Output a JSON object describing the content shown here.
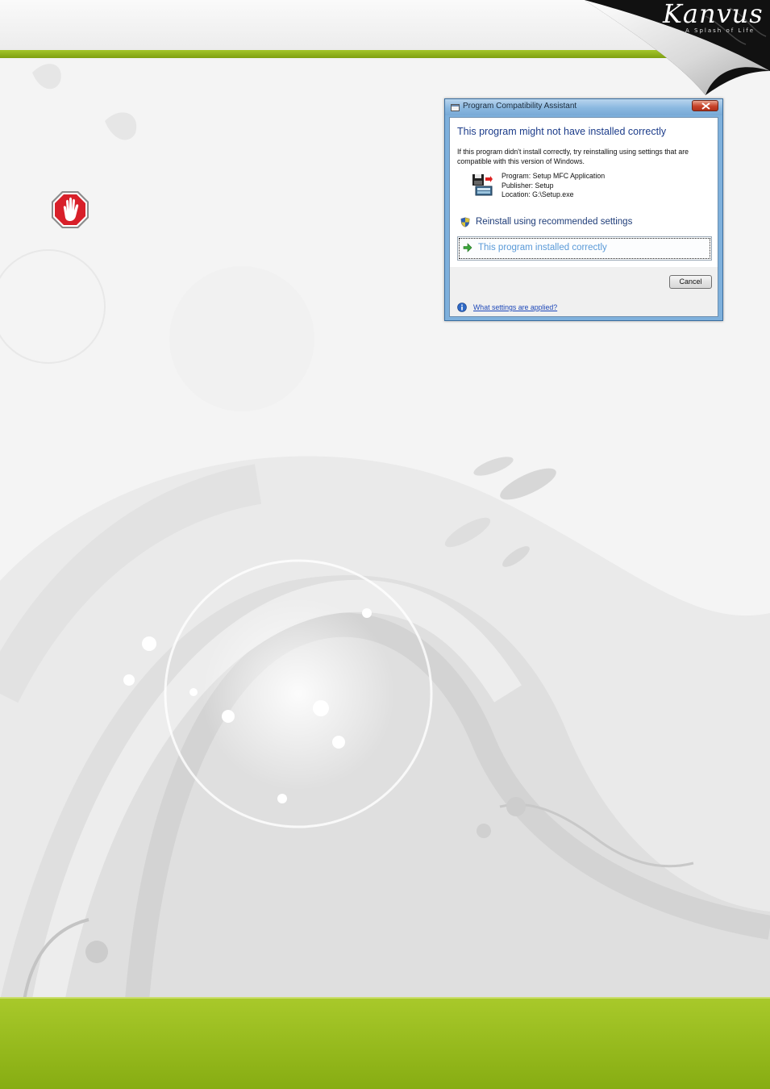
{
  "brand": {
    "logo_text": "Kanvus",
    "tagline": "A Splash of Life"
  },
  "colors": {
    "accent_green": "#96b71f",
    "dialog_frame": "#7eb0dc",
    "heading_blue": "#1c3c8a",
    "link_blue": "#1c47b8"
  },
  "icons": {
    "stop": "stop-hand-icon",
    "title": "window-icon",
    "program": "floppy-disk-icon",
    "shield": "shield-icon",
    "arrow": "green-arrow-icon",
    "info": "info-icon"
  },
  "dialog": {
    "title": "Program Compatibility Assistant",
    "heading": "This program might not have installed correctly",
    "description": "If this program didn't install correctly, try reinstalling using settings that are compatible with this version of Windows.",
    "program_line": "Program: Setup MFC Application",
    "publisher_line": "Publisher: Setup",
    "location_line": "Location: G:\\Setup.exe",
    "option_reinstall": "Reinstall using recommended settings",
    "option_installed": "This program installed correctly",
    "cancel_label": "Cancel",
    "help_link": "What settings are applied?"
  }
}
